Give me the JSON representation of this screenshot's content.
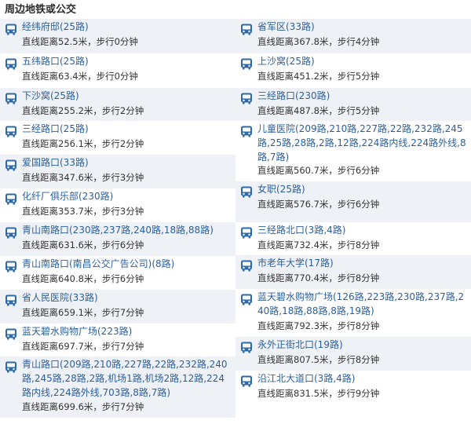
{
  "section_title": "周边地铁或公交",
  "icon": "bus-icon",
  "accent_color": "#2a5f9e",
  "left": [
    {
      "name": "经纬府邸(25路)",
      "dist": "直线距离52.5米，步行0分钟"
    },
    {
      "name": "五纬路口(25路)",
      "dist": "直线距离63.4米，步行0分钟"
    },
    {
      "name": "下沙窝(25路)",
      "dist": "直线距离255.2米，步行2分钟"
    },
    {
      "name": "三经路口(25路)",
      "dist": "直线距离256.1米，步行2分钟"
    },
    {
      "name": "爱国路口(33路)",
      "dist": "直线距离347.6米，步行3分钟"
    },
    {
      "name": "化纤厂俱乐部(230路)",
      "dist": "直线距离353.7米，步行3分钟"
    },
    {
      "name": "青山南路口(230路,237路,240路,18路,88路)",
      "dist": "直线距离631.6米，步行6分钟"
    },
    {
      "name": "青山南路口(南昌公交广告公司)(8路)",
      "dist": "直线距离640.8米，步行6分钟"
    },
    {
      "name": "省人民医院(33路)",
      "dist": "直线距离659.1米，步行7分钟"
    },
    {
      "name": "蓝天碧水购物广场(223路)",
      "dist": "直线距离697.7米，步行7分钟"
    },
    {
      "name": "青山路口(209路,210路,227路,22路,232路,240路,245路,28路,2路,机场1路,机场2路,12路,224路内线,224路外线,703路,8路,7路)",
      "dist": "直线距离699.6米，步行7分钟"
    }
  ],
  "right": [
    {
      "name": "省军区(33路)",
      "dist": "直线距离367.8米，步行4分钟"
    },
    {
      "name": "上沙窝(25路)",
      "dist": "直线距离451.2米，步行5分钟"
    },
    {
      "name": "三经路口(230路)",
      "dist": "直线距离487.8米，步行5分钟"
    },
    {
      "name": "儿童医院(209路,210路,227路,22路,232路,245路,25路,28路,2路,12路,224路内线,224路外线,8路,7路)",
      "dist": "直线距离560.7米，步行6分钟"
    },
    {
      "name": "女职(25路)",
      "dist": "直线距离576.7米，步行6分钟"
    },
    {
      "name": "三经路北口(3路,4路)",
      "dist": "直线距离732.4米，步行8分钟"
    },
    {
      "name": "市老年大学(17路)",
      "dist": "直线距离770.4米，步行8分钟"
    },
    {
      "name": "蓝天碧水购物广场(126路,223路,230路,237路,240路,18路,88路,8路,19路)",
      "dist": "直线距离792.3米，步行8分钟"
    },
    {
      "name": "永外正街北口(19路)",
      "dist": "直线距离807.5米，步行8分钟"
    },
    {
      "name": "沿江北大道口(3路,4路)",
      "dist": "直线距离831.5米，步行9分钟"
    }
  ]
}
